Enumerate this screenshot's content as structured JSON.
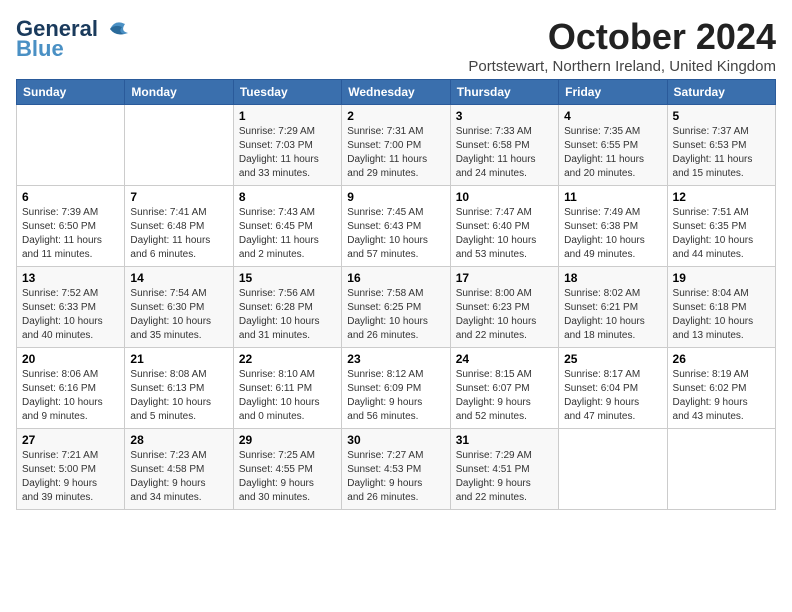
{
  "logo": {
    "line1": "General",
    "line2": "Blue"
  },
  "title": "October 2024",
  "location": "Portstewart, Northern Ireland, United Kingdom",
  "days_header": [
    "Sunday",
    "Monday",
    "Tuesday",
    "Wednesday",
    "Thursday",
    "Friday",
    "Saturday"
  ],
  "weeks": [
    [
      {
        "day": "",
        "info": ""
      },
      {
        "day": "",
        "info": ""
      },
      {
        "day": "1",
        "info": "Sunrise: 7:29 AM\nSunset: 7:03 PM\nDaylight: 11 hours\nand 33 minutes."
      },
      {
        "day": "2",
        "info": "Sunrise: 7:31 AM\nSunset: 7:00 PM\nDaylight: 11 hours\nand 29 minutes."
      },
      {
        "day": "3",
        "info": "Sunrise: 7:33 AM\nSunset: 6:58 PM\nDaylight: 11 hours\nand 24 minutes."
      },
      {
        "day": "4",
        "info": "Sunrise: 7:35 AM\nSunset: 6:55 PM\nDaylight: 11 hours\nand 20 minutes."
      },
      {
        "day": "5",
        "info": "Sunrise: 7:37 AM\nSunset: 6:53 PM\nDaylight: 11 hours\nand 15 minutes."
      }
    ],
    [
      {
        "day": "6",
        "info": "Sunrise: 7:39 AM\nSunset: 6:50 PM\nDaylight: 11 hours\nand 11 minutes."
      },
      {
        "day": "7",
        "info": "Sunrise: 7:41 AM\nSunset: 6:48 PM\nDaylight: 11 hours\nand 6 minutes."
      },
      {
        "day": "8",
        "info": "Sunrise: 7:43 AM\nSunset: 6:45 PM\nDaylight: 11 hours\nand 2 minutes."
      },
      {
        "day": "9",
        "info": "Sunrise: 7:45 AM\nSunset: 6:43 PM\nDaylight: 10 hours\nand 57 minutes."
      },
      {
        "day": "10",
        "info": "Sunrise: 7:47 AM\nSunset: 6:40 PM\nDaylight: 10 hours\nand 53 minutes."
      },
      {
        "day": "11",
        "info": "Sunrise: 7:49 AM\nSunset: 6:38 PM\nDaylight: 10 hours\nand 49 minutes."
      },
      {
        "day": "12",
        "info": "Sunrise: 7:51 AM\nSunset: 6:35 PM\nDaylight: 10 hours\nand 44 minutes."
      }
    ],
    [
      {
        "day": "13",
        "info": "Sunrise: 7:52 AM\nSunset: 6:33 PM\nDaylight: 10 hours\nand 40 minutes."
      },
      {
        "day": "14",
        "info": "Sunrise: 7:54 AM\nSunset: 6:30 PM\nDaylight: 10 hours\nand 35 minutes."
      },
      {
        "day": "15",
        "info": "Sunrise: 7:56 AM\nSunset: 6:28 PM\nDaylight: 10 hours\nand 31 minutes."
      },
      {
        "day": "16",
        "info": "Sunrise: 7:58 AM\nSunset: 6:25 PM\nDaylight: 10 hours\nand 26 minutes."
      },
      {
        "day": "17",
        "info": "Sunrise: 8:00 AM\nSunset: 6:23 PM\nDaylight: 10 hours\nand 22 minutes."
      },
      {
        "day": "18",
        "info": "Sunrise: 8:02 AM\nSunset: 6:21 PM\nDaylight: 10 hours\nand 18 minutes."
      },
      {
        "day": "19",
        "info": "Sunrise: 8:04 AM\nSunset: 6:18 PM\nDaylight: 10 hours\nand 13 minutes."
      }
    ],
    [
      {
        "day": "20",
        "info": "Sunrise: 8:06 AM\nSunset: 6:16 PM\nDaylight: 10 hours\nand 9 minutes."
      },
      {
        "day": "21",
        "info": "Sunrise: 8:08 AM\nSunset: 6:13 PM\nDaylight: 10 hours\nand 5 minutes."
      },
      {
        "day": "22",
        "info": "Sunrise: 8:10 AM\nSunset: 6:11 PM\nDaylight: 10 hours\nand 0 minutes."
      },
      {
        "day": "23",
        "info": "Sunrise: 8:12 AM\nSunset: 6:09 PM\nDaylight: 9 hours\nand 56 minutes."
      },
      {
        "day": "24",
        "info": "Sunrise: 8:15 AM\nSunset: 6:07 PM\nDaylight: 9 hours\nand 52 minutes."
      },
      {
        "day": "25",
        "info": "Sunrise: 8:17 AM\nSunset: 6:04 PM\nDaylight: 9 hours\nand 47 minutes."
      },
      {
        "day": "26",
        "info": "Sunrise: 8:19 AM\nSunset: 6:02 PM\nDaylight: 9 hours\nand 43 minutes."
      }
    ],
    [
      {
        "day": "27",
        "info": "Sunrise: 7:21 AM\nSunset: 5:00 PM\nDaylight: 9 hours\nand 39 minutes."
      },
      {
        "day": "28",
        "info": "Sunrise: 7:23 AM\nSunset: 4:58 PM\nDaylight: 9 hours\nand 34 minutes."
      },
      {
        "day": "29",
        "info": "Sunrise: 7:25 AM\nSunset: 4:55 PM\nDaylight: 9 hours\nand 30 minutes."
      },
      {
        "day": "30",
        "info": "Sunrise: 7:27 AM\nSunset: 4:53 PM\nDaylight: 9 hours\nand 26 minutes."
      },
      {
        "day": "31",
        "info": "Sunrise: 7:29 AM\nSunset: 4:51 PM\nDaylight: 9 hours\nand 22 minutes."
      },
      {
        "day": "",
        "info": ""
      },
      {
        "day": "",
        "info": ""
      }
    ]
  ]
}
